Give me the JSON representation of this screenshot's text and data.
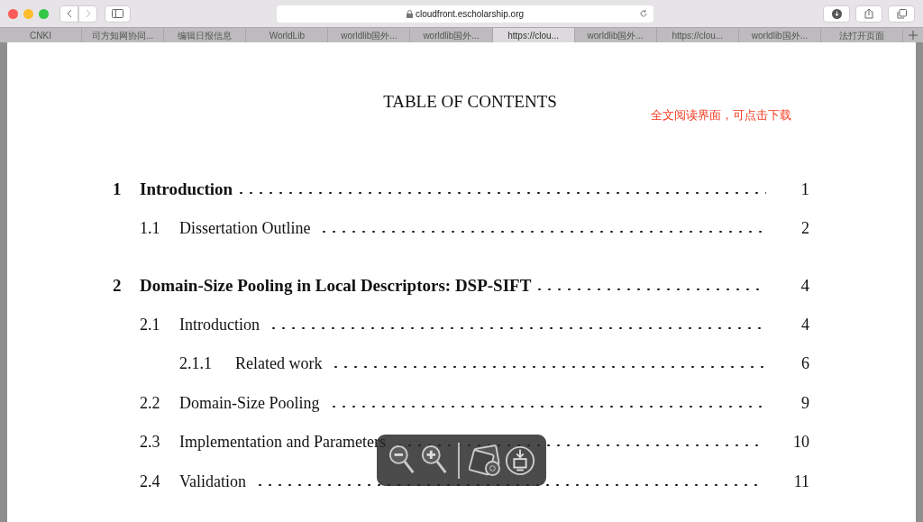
{
  "browser": {
    "address": "cloudfront.escholarship.org",
    "tabs": [
      {
        "label": "CNKI",
        "selected": false
      },
      {
        "label": "司方知网协同...",
        "selected": false
      },
      {
        "label": "编辑日报信息",
        "selected": false
      },
      {
        "label": "WorldLib",
        "selected": false
      },
      {
        "label": "worldlib国外...",
        "selected": false
      },
      {
        "label": "worldlib国外...",
        "selected": false
      },
      {
        "label": "https://clou...",
        "selected": true
      },
      {
        "label": "worldlib国外...",
        "selected": false
      },
      {
        "label": "https://clou...",
        "selected": false
      },
      {
        "label": "worldlib国外...",
        "selected": false
      },
      {
        "label": "法打开页面",
        "selected": false
      }
    ]
  },
  "document": {
    "title": "TABLE OF CONTENTS",
    "note": "全文阅读界面，可点击下载",
    "entries": [
      {
        "kind": "chapter",
        "number": "1",
        "title": "Introduction",
        "page": "1"
      },
      {
        "kind": "section",
        "number": "1.1",
        "title": "Dissertation Outline",
        "page": "2"
      },
      {
        "kind": "chapter",
        "number": "2",
        "title": "Domain-Size Pooling in Local Descriptors: DSP-SIFT",
        "page": "4"
      },
      {
        "kind": "section",
        "number": "2.1",
        "title": "Introduction",
        "page": "4"
      },
      {
        "kind": "subsection",
        "number": "2.1.1",
        "title": "Related work",
        "page": "6"
      },
      {
        "kind": "section",
        "number": "2.2",
        "title": "Domain-Size Pooling",
        "page": "9"
      },
      {
        "kind": "section",
        "number": "2.3",
        "title": "Implementation and Parameters",
        "page": "10"
      },
      {
        "kind": "section",
        "number": "2.4",
        "title": "Validation",
        "page": "11"
      }
    ]
  }
}
